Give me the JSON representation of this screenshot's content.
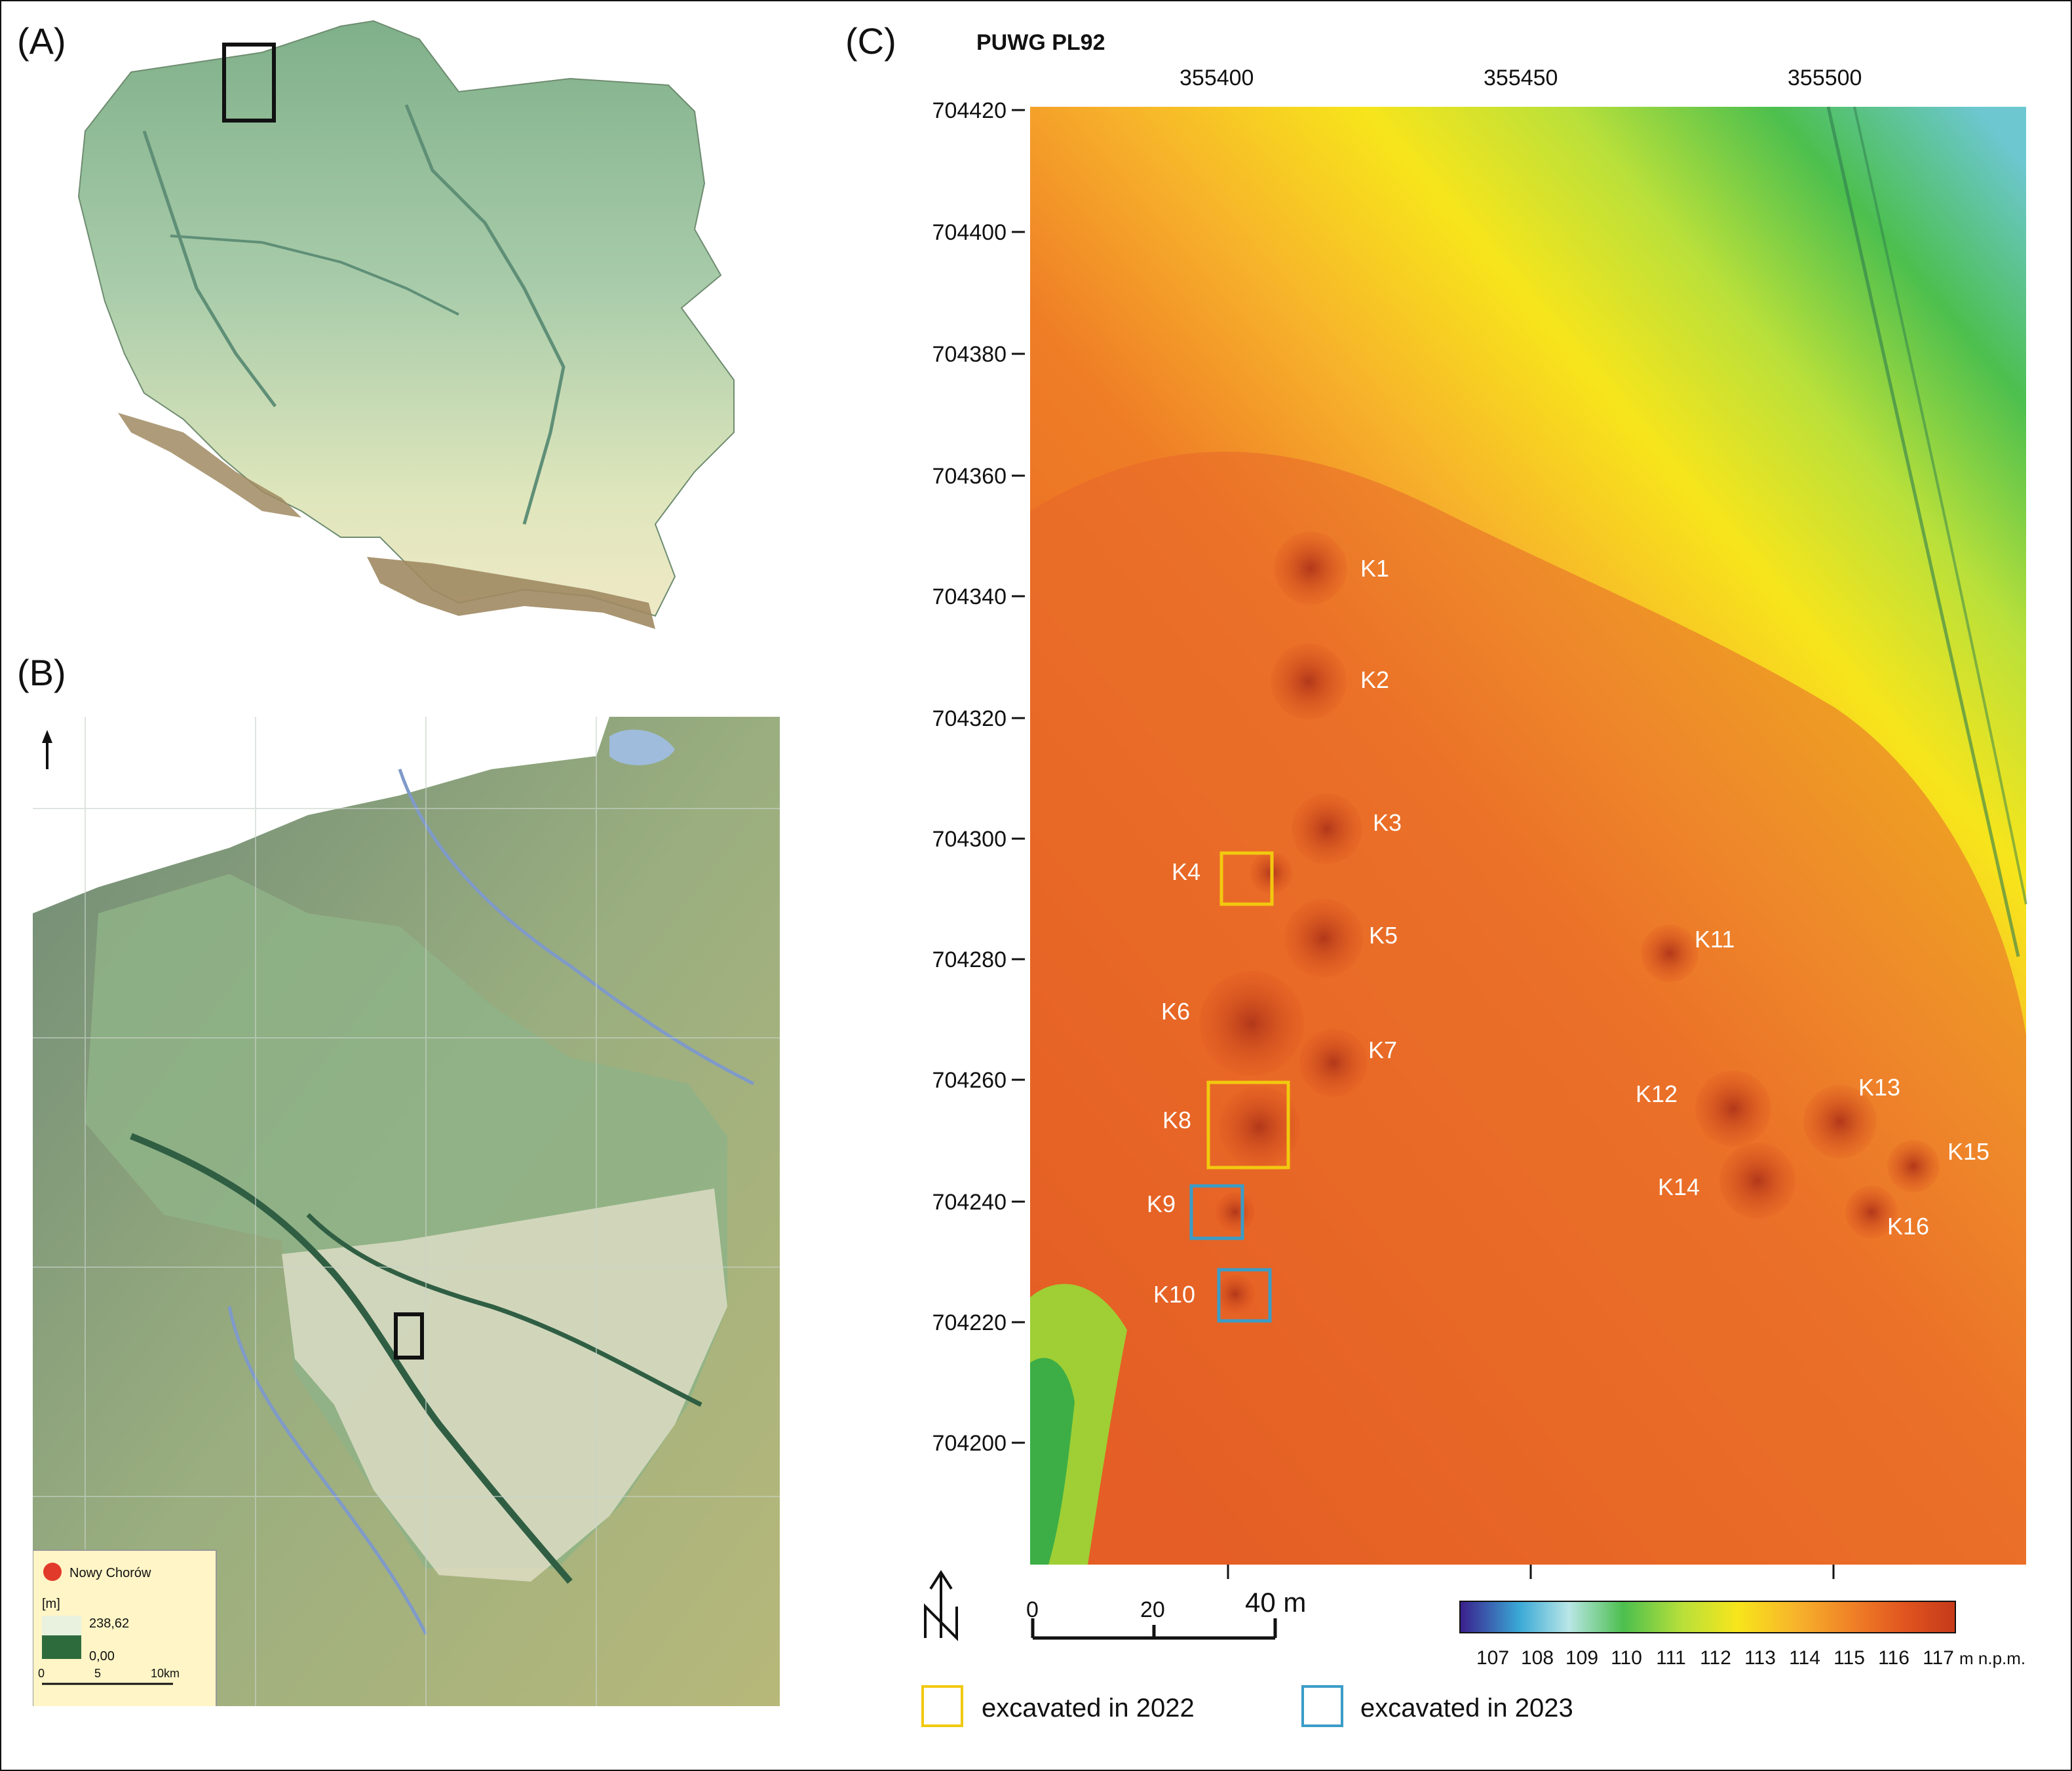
{
  "panels": {
    "a": {
      "label": "(A)"
    },
    "b": {
      "label": "(B)"
    },
    "c": {
      "label": "(C)"
    }
  },
  "panel_b": {
    "legend": {
      "site_name": "Nowy Chorów",
      "unit": "[m]",
      "max_value": "238,62",
      "min_value": "0,00",
      "scale_ticks": [
        "0",
        "5",
        "10km"
      ]
    }
  },
  "panel_c": {
    "crs_label": "PUWG PL92",
    "x_ticks": [
      "355400",
      "355450",
      "355500"
    ],
    "y_ticks": [
      "704420",
      "704400",
      "704380",
      "704360",
      "704340",
      "704320",
      "704300",
      "704280",
      "704260",
      "704240",
      "704220",
      "704200"
    ],
    "kurgans": [
      {
        "id": "K1",
        "label": "K1"
      },
      {
        "id": "K2",
        "label": "K2"
      },
      {
        "id": "K3",
        "label": "K3"
      },
      {
        "id": "K4",
        "label": "K4"
      },
      {
        "id": "K5",
        "label": "K5"
      },
      {
        "id": "K6",
        "label": "K6"
      },
      {
        "id": "K7",
        "label": "K7"
      },
      {
        "id": "K8",
        "label": "K8"
      },
      {
        "id": "K9",
        "label": "K9"
      },
      {
        "id": "K10",
        "label": "K10"
      },
      {
        "id": "K11",
        "label": "K11"
      },
      {
        "id": "K12",
        "label": "K12"
      },
      {
        "id": "K13",
        "label": "K13"
      },
      {
        "id": "K14",
        "label": "K14"
      },
      {
        "id": "K15",
        "label": "K15"
      },
      {
        "id": "K16",
        "label": "K16"
      }
    ],
    "scale_bar": {
      "ticks": [
        "0",
        "20",
        "40 m"
      ]
    },
    "elevation_legend": {
      "ticks": [
        "107",
        "108",
        "109",
        "110",
        "111",
        "112",
        "113",
        "114",
        "115",
        "116",
        "117"
      ],
      "unit": "m n.p.m.",
      "colors": [
        "#3a1f8c",
        "#3aa9d6",
        "#b9e6e6",
        "#4cbf4e",
        "#b9e03a",
        "#f7e51b",
        "#f7b32b",
        "#ef7d26",
        "#e0541f",
        "#c53a1a"
      ]
    },
    "legend": [
      {
        "label": "excavated in 2022",
        "color": "#f2c90f"
      },
      {
        "label": "excavated in 2023",
        "color": "#3b9cc7"
      }
    ]
  }
}
